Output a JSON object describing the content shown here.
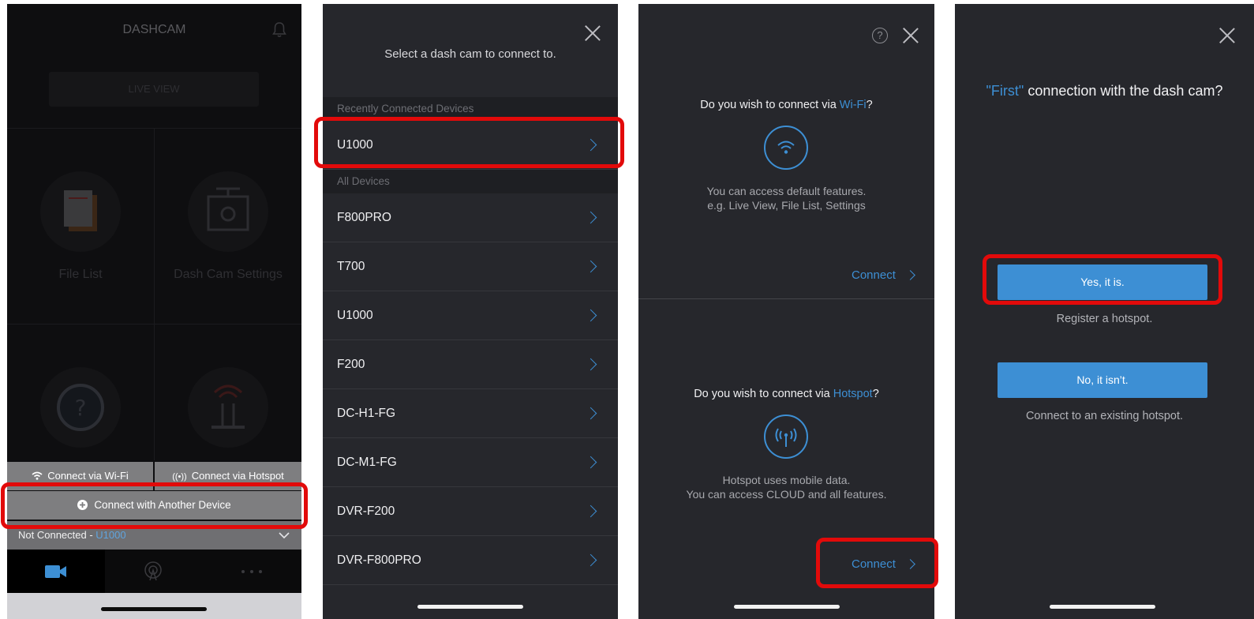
{
  "panel1": {
    "title": "DASHCAM",
    "live_view": "LIVE VIEW",
    "tiles": [
      {
        "label": "File List",
        "icon": "file-list-icon"
      },
      {
        "label": "Dash Cam Settings",
        "icon": "settings-icon"
      },
      {
        "label": "",
        "icon": "help-icon"
      },
      {
        "label": "",
        "icon": "router-icon"
      }
    ],
    "connect_wifi": "Connect via Wi-Fi",
    "connect_hotspot": "Connect via Hotspot",
    "connect_another": "Connect with Another Device",
    "status_prefix": "Not Connected - ",
    "status_device": "U1000",
    "tabs": [
      "camera-icon",
      "cloud-icon",
      "more-icon"
    ]
  },
  "panel2": {
    "prompt": "Select a dash cam to connect to.",
    "recent_header": "Recently Connected Devices",
    "recent": [
      "U1000"
    ],
    "all_header": "All Devices",
    "devices": [
      "F800PRO",
      "T700",
      "U1000",
      "F200",
      "DC-H1-FG",
      "DC-M1-FG",
      "DVR-F200",
      "DVR-F800PRO"
    ]
  },
  "panel3": {
    "wifi_q_prefix": "Do you wish to connect via ",
    "wifi_q_accent": "Wi-Fi",
    "wifi_q_suffix": "?",
    "wifi_desc_1": "You can access default features.",
    "wifi_desc_2": "e.g. Live View, File List, Settings",
    "connect_label": "Connect",
    "hotspot_q_prefix": "Do you wish to connect via ",
    "hotspot_q_accent": "Hotspot",
    "hotspot_q_suffix": "?",
    "hotspot_desc_1": "Hotspot uses mobile data.",
    "hotspot_desc_2": "You can access CLOUD and all features.",
    "connect_label_2": "Connect",
    "help_glyph": "?"
  },
  "panel4": {
    "question_accent": "\"First\"",
    "question_rest": " connection with the dash cam?",
    "yes_label": "Yes, it is.",
    "yes_desc": "Register a hotspot.",
    "no_label": "No, it isn’t.",
    "no_desc": "Connect to an existing hotspot."
  },
  "colors": {
    "accent": "#3d8fd4",
    "highlight": "#e20a0a",
    "panel_bg": "#26272c"
  }
}
